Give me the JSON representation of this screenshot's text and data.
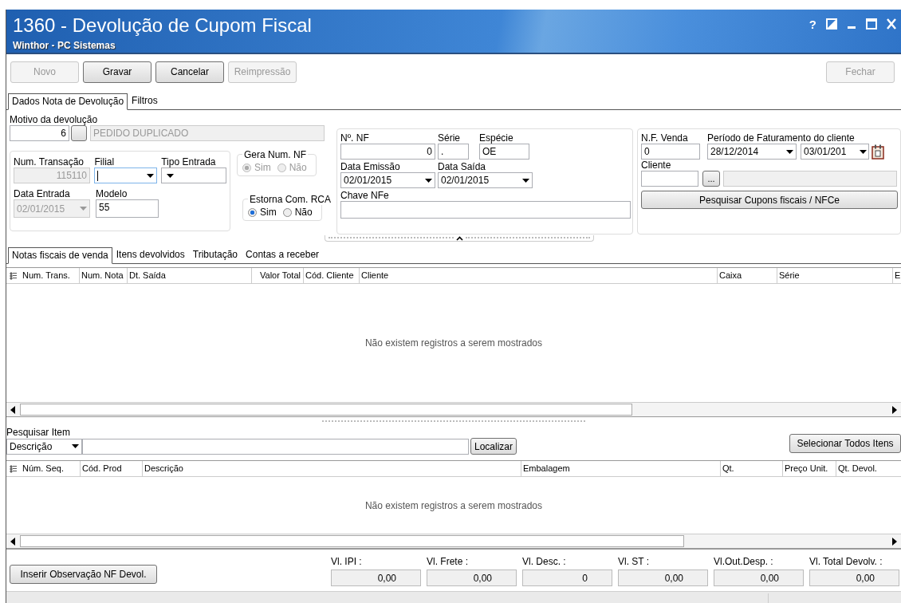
{
  "window": {
    "title": "1360 - Devolução de Cupom Fiscal",
    "subtitle": "Winthor - PC Sistemas",
    "help": "?"
  },
  "toolbar": [
    {
      "label": "Novo",
      "disabled": true
    },
    {
      "label": "Gravar",
      "disabled": false
    },
    {
      "label": "Cancelar",
      "disabled": false
    },
    {
      "label": "Reimpressão",
      "disabled": true
    }
  ],
  "close_button": {
    "label": "Fechar",
    "disabled": true
  },
  "form_tabs": [
    {
      "label": "Dados Nota de Devolução",
      "selected": true
    },
    {
      "label": "Filtros",
      "selected": false
    }
  ],
  "motivo": {
    "label": "Motivo da devolução",
    "code": "6",
    "description": "PEDIDO DUPLICADO"
  },
  "transacao": {
    "label": "Num. Transação",
    "value": "115110",
    "disabled": true
  },
  "filial": {
    "label": "Filial"
  },
  "tipo_entrada": {
    "label": "Tipo Entrada"
  },
  "data_entrada": {
    "label": "Data Entrada",
    "value": "02/01/2015",
    "disabled": true
  },
  "modelo": {
    "label": "Modelo",
    "value": "55"
  },
  "gera_num_nf": {
    "label": "Gera Num. NF",
    "disabled": true,
    "options": [
      {
        "label": "Sim",
        "selected": true
      },
      {
        "label": "Não",
        "selected": false
      }
    ]
  },
  "estorna_com_rca": {
    "label": "Estorna Com. RCA",
    "disabled": false,
    "options": [
      {
        "label": "Sim",
        "selected": true
      },
      {
        "label": "Não",
        "selected": false
      }
    ]
  },
  "nf": {
    "label": "Nº. NF",
    "value": "0"
  },
  "serie": {
    "label": "Série",
    "value": "."
  },
  "especie": {
    "label": "Espécie",
    "value": "OE"
  },
  "data_emissao": {
    "label": "Data Emissão",
    "value": "02/01/2015"
  },
  "data_saida": {
    "label": "Data Saída",
    "value": "02/01/2015"
  },
  "chave_nfe": {
    "label": "Chave NFe"
  },
  "nf_venda": {
    "label": "N.F. Venda",
    "value": "0"
  },
  "periodo": {
    "label": "Período de Faturamento do cliente",
    "from": "28/12/2014",
    "to": "03/01/201"
  },
  "cliente": {
    "label": "Cliente",
    "lookup": "..."
  },
  "search_button": "Pesquisar Cupons fiscais / NFCe",
  "grid_tabs": [
    {
      "label": "Notas fiscais de venda",
      "selected": true
    },
    {
      "label": "Itens devolvidos",
      "selected": false
    },
    {
      "label": "Tributação",
      "selected": false
    },
    {
      "label": "Contas a receber",
      "selected": false
    }
  ],
  "invoices_grid": {
    "columns": [
      "Num. Trans.",
      "Num. Nota",
      "Dt. Saída",
      "Valor Total",
      "Cód. Cliente",
      "Cliente",
      "Caixa",
      "Série",
      "E"
    ],
    "empty_message": "Não existem registros a serem mostrados"
  },
  "item_search": {
    "label": "Pesquisar Item",
    "field": "Descrição",
    "button": "Localizar",
    "select_all": "Selecionar Todos Itens"
  },
  "items_grid": {
    "columns": [
      "Núm. Seq.",
      "Cód. Prod",
      "Descrição",
      "Embalagem",
      "Qt.",
      "Preço Unit.",
      "Qt. Devol."
    ],
    "empty_message": "Não existem registros a serem mostrados"
  },
  "observation_button": "Inserir Observação NF Devol.",
  "totals": [
    {
      "label": "Vl. IPI :",
      "value": "0,00"
    },
    {
      "label": "Vl. Frete :",
      "value": "0,00"
    },
    {
      "label": "Vl. Desc. :",
      "value": "0"
    },
    {
      "label": "Vl. ST :",
      "value": "0,00"
    },
    {
      "label": "Vl.Out.Desp. :",
      "value": "0,00"
    },
    {
      "label": "Vl. Total Devolv. :",
      "value": "0,00"
    }
  ]
}
